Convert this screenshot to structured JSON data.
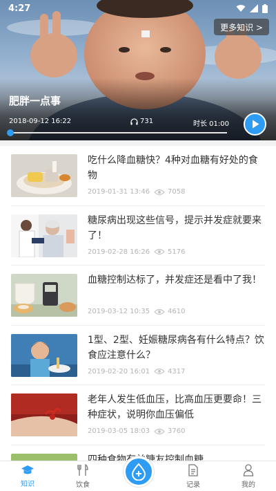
{
  "status_bar": {
    "time": "4:27"
  },
  "hero": {
    "more_label": "更多知识 >",
    "title": "肥胖一点事",
    "date": "2018-09-12 16:22",
    "listen_count": "731",
    "duration": "时长 01:00",
    "progress": 0.0
  },
  "articles": [
    {
      "title": "吃什么降血糖快？4种对血糖有好处的食物",
      "date": "2019-01-31 13:46",
      "views": "7058"
    },
    {
      "title": "糖尿病出现这些信号，提示并发症就要来了！",
      "date": "2019-02-28 16:26",
      "views": "5176"
    },
    {
      "title": "血糖控制达标了，并发症还是看中了我！",
      "date": "2019-03-12 10:35",
      "views": "4610"
    },
    {
      "title": "1型、2型、妊娠糖尿病各有什么特点？饮食应注意什么？",
      "date": "2019-02-20 16:01",
      "views": "4317"
    },
    {
      "title": "老年人发生低血压，比高血压更要命！三种症状，说明你血压偏低",
      "date": "2019-03-05 18:03",
      "views": "3760"
    },
    {
      "title": "四种食物有益糖友控制血糖",
      "date": "",
      "views": ""
    }
  ],
  "tabbar": {
    "items": [
      {
        "label": "知识",
        "icon": "graduation-cap-icon",
        "active": true
      },
      {
        "label": "饮食",
        "icon": "fork-knife-icon",
        "active": false
      },
      {
        "label": "",
        "icon": "water-drop-plus-icon",
        "active": false
      },
      {
        "label": "记录",
        "icon": "document-icon",
        "active": false
      },
      {
        "label": "我的",
        "icon": "person-icon",
        "active": false
      }
    ]
  },
  "colors": {
    "accent": "#2f9cf4",
    "meta_text": "#b4b4b4"
  }
}
